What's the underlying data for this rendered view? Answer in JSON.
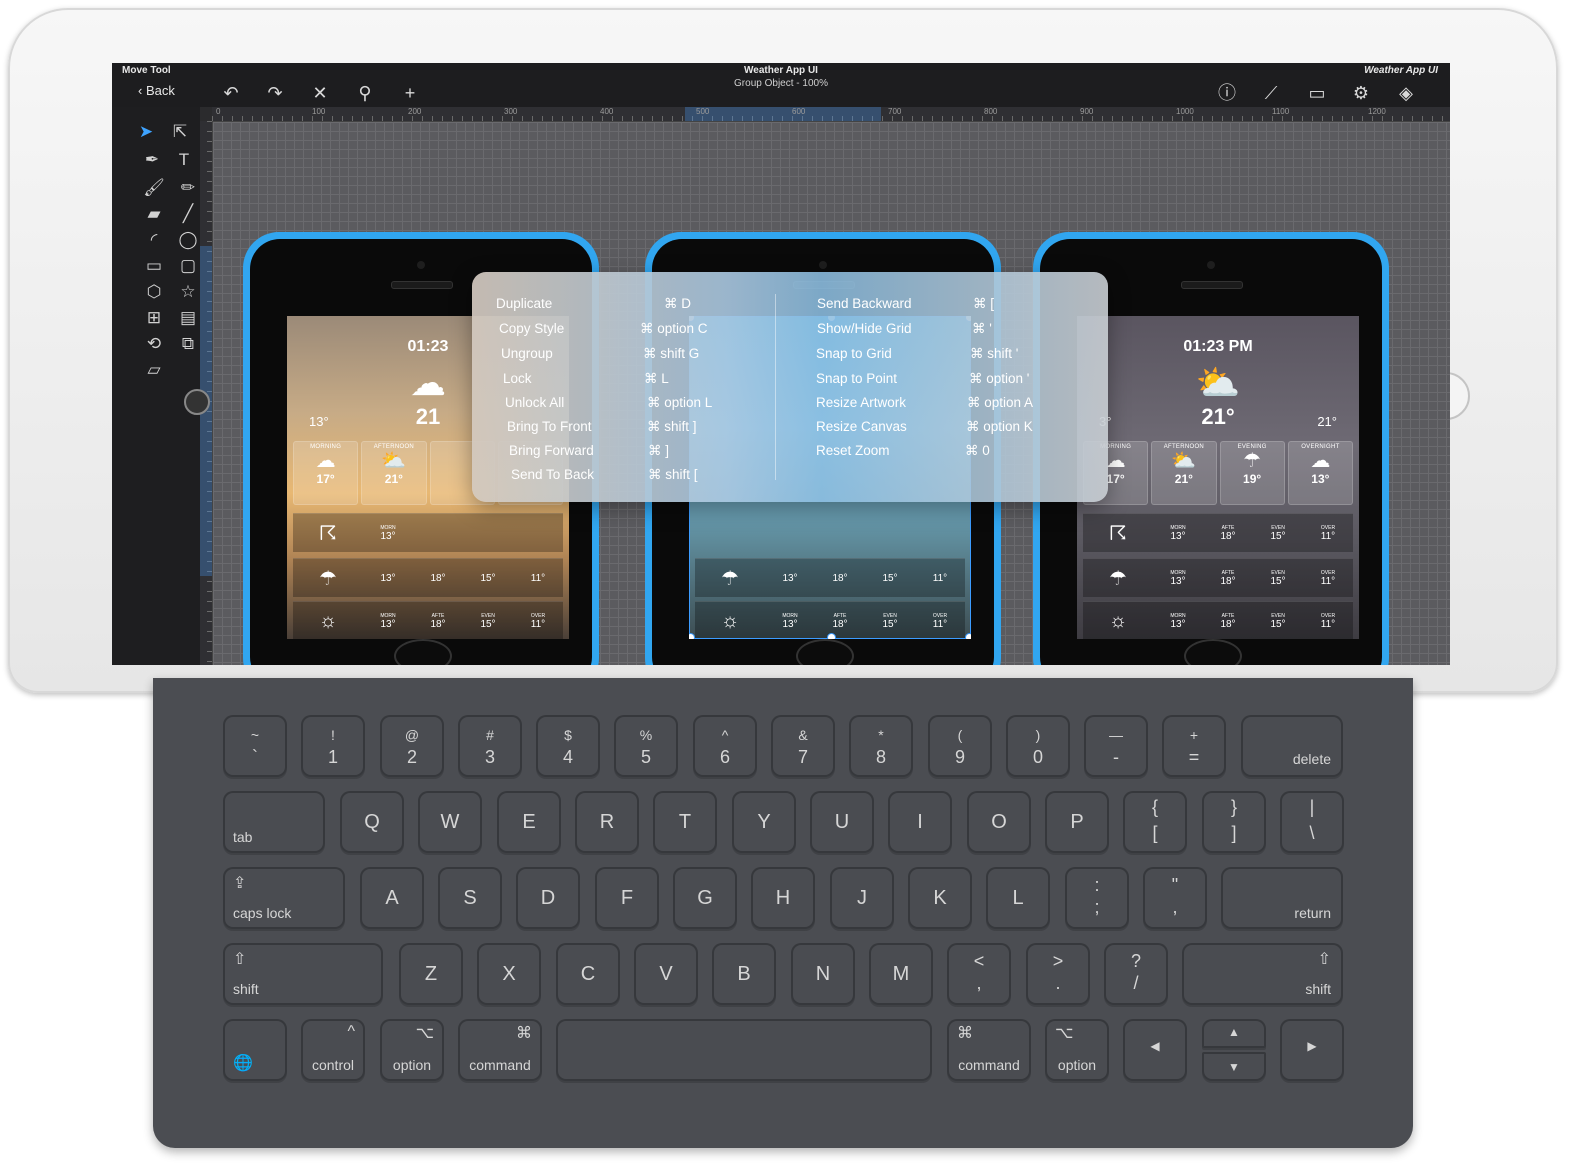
{
  "app": {
    "tool_name": "Move Tool",
    "document_title": "Weather App UI",
    "document_subtitle": "Group Object - 100%",
    "document_right": "Weather App UI",
    "back_label": "Back"
  },
  "ruler_ticks": [
    "0",
    "100",
    "200",
    "300",
    "400",
    "500",
    "600",
    "700",
    "800",
    "900",
    "1000",
    "1100",
    "1200"
  ],
  "phones": [
    {
      "time": "01:23",
      "temp": "21",
      "lo": "13°",
      "hi": "21°",
      "periods": [
        "MORNING",
        "AFTERNOON"
      ],
      "period_temps": [
        "17°",
        "21°"
      ],
      "strip1": [
        {
          "l": "MORN",
          "v": "13°"
        }
      ],
      "strip2": [
        {
          "l": "",
          "v": "13°"
        },
        {
          "l": "",
          "v": "18°"
        },
        {
          "l": "",
          "v": "15°"
        },
        {
          "l": "",
          "v": "11°"
        }
      ],
      "strip3": [
        {
          "l": "MORN",
          "v": "13°"
        },
        {
          "l": "AFTE",
          "v": "18°"
        },
        {
          "l": "EVEN",
          "v": "15°"
        },
        {
          "l": "OVER",
          "v": "11°"
        }
      ]
    },
    {
      "time": "",
      "temp": "",
      "lo": "",
      "hi": "",
      "periods": [],
      "period_temps": [],
      "strip1": [],
      "strip2": [
        {
          "l": "",
          "v": "13°"
        },
        {
          "l": "",
          "v": "18°"
        },
        {
          "l": "",
          "v": "15°"
        },
        {
          "l": "",
          "v": "11°"
        }
      ],
      "strip3": [
        {
          "l": "MORN",
          "v": "13°"
        },
        {
          "l": "AFTE",
          "v": "18°"
        },
        {
          "l": "EVEN",
          "v": "15°"
        },
        {
          "l": "OVER",
          "v": "11°"
        }
      ]
    },
    {
      "time": "01:23 PM",
      "temp": "21°",
      "lo": "3°",
      "hi": "21°",
      "periods": [
        "MORNING",
        "AFTERNOON",
        "EVENING",
        "OVERNIGHT"
      ],
      "period_temps": [
        "17°",
        "21°",
        "19°",
        "13°"
      ],
      "strip1": [
        {
          "l": "MORN",
          "v": "13°"
        },
        {
          "l": "AFTE",
          "v": "18°"
        },
        {
          "l": "EVEN",
          "v": "15°"
        },
        {
          "l": "OVER",
          "v": "11°"
        }
      ],
      "strip2": [
        {
          "l": "MORN",
          "v": "13°"
        },
        {
          "l": "AFTE",
          "v": "18°"
        },
        {
          "l": "EVEN",
          "v": "15°"
        },
        {
          "l": "OVER",
          "v": "11°"
        }
      ],
      "strip3": [
        {
          "l": "MORN",
          "v": "13°"
        },
        {
          "l": "AFTE",
          "v": "18°"
        },
        {
          "l": "EVEN",
          "v": "15°"
        },
        {
          "l": "OVER",
          "v": "11°"
        }
      ]
    }
  ],
  "shortcuts": {
    "left": [
      {
        "name": "Duplicate",
        "keys": "⌘ D"
      },
      {
        "name": "Copy Style",
        "keys": "⌘ option C"
      },
      {
        "name": "Ungroup",
        "keys": "⌘ shift G"
      },
      {
        "name": "Lock",
        "keys": "⌘ L"
      },
      {
        "name": "Unlock All",
        "keys": "⌘ option L"
      },
      {
        "name": "Bring To Front",
        "keys": "⌘ shift ]"
      },
      {
        "name": "Bring Forward",
        "keys": "⌘ ]"
      },
      {
        "name": "Send To Back",
        "keys": "⌘ shift ["
      }
    ],
    "right": [
      {
        "name": "Send Backward",
        "keys": "⌘ ["
      },
      {
        "name": "Show/Hide Grid",
        "keys": "⌘ '"
      },
      {
        "name": "Snap to Grid",
        "keys": "⌘ shift '"
      },
      {
        "name": "Snap to Point",
        "keys": "⌘ option '"
      },
      {
        "name": "Resize Artwork",
        "keys": "⌘ option A"
      },
      {
        "name": "Resize Canvas",
        "keys": "⌘ option K"
      },
      {
        "name": "Reset Zoom",
        "keys": "⌘ 0"
      }
    ]
  },
  "keyboard": {
    "row1": [
      {
        "top": "~",
        "bot": "`"
      },
      {
        "top": "!",
        "bot": "1"
      },
      {
        "top": "@",
        "bot": "2"
      },
      {
        "top": "#",
        "bot": "3"
      },
      {
        "top": "$",
        "bot": "4"
      },
      {
        "top": "%",
        "bot": "5"
      },
      {
        "top": "^",
        "bot": "6"
      },
      {
        "top": "&",
        "bot": "7"
      },
      {
        "top": "*",
        "bot": "8"
      },
      {
        "top": "(",
        "bot": "9"
      },
      {
        "top": ")",
        "bot": "0"
      },
      {
        "top": "—",
        "bot": "-"
      },
      {
        "top": "+",
        "bot": "="
      }
    ],
    "delete": "delete",
    "tab": "tab",
    "row2": [
      "Q",
      "W",
      "E",
      "R",
      "T",
      "Y",
      "U",
      "I",
      "O",
      "P"
    ],
    "row2_sym": [
      {
        "top": "{",
        "bot": "["
      },
      {
        "top": "}",
        "bot": "]"
      },
      {
        "top": "|",
        "bot": "\\"
      }
    ],
    "caps": "caps lock",
    "row3": [
      "A",
      "S",
      "D",
      "F",
      "G",
      "H",
      "J",
      "K",
      "L"
    ],
    "row3_sym": [
      {
        "top": ":",
        "bot": ";"
      },
      {
        "top": "\"",
        "bot": ","
      }
    ],
    "return": "return",
    "shift": "shift",
    "row4": [
      "Z",
      "X",
      "C",
      "V",
      "B",
      "N",
      "M"
    ],
    "row4_sym": [
      {
        "top": "<",
        "bot": ","
      },
      {
        "top": ">",
        "bot": "."
      },
      {
        "top": "?",
        "bot": "/"
      }
    ],
    "control": "control",
    "option": "option",
    "command": "command"
  },
  "colors": {
    "phone_case": "#31a6f0",
    "selection": "#3c9cff",
    "active_tool": "#3ea3ff"
  }
}
